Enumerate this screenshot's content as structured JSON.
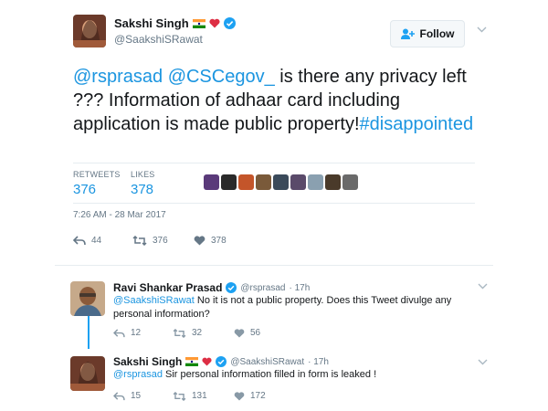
{
  "colors": {
    "link": "#1b95e0",
    "muted": "#657786",
    "heart": "#e0245e",
    "verified": "#1da1f2"
  },
  "main_tweet": {
    "author_name": "Sakshi Singh",
    "author_handle": "@SaakshiSRawat",
    "follow_label": "Follow",
    "text_mention_1": "@rsprasad",
    "text_mention_2": "@CSCegov_",
    "text_body": " is there any privacy left ??? Information of adhaar card including application is made public property!",
    "text_hashtag": "#disappointed",
    "retweets_label": "RETWEETS",
    "retweets_count": "376",
    "likes_label": "LIKES",
    "likes_count": "378",
    "timestamp": "7:26 AM - 28 Mar 2017",
    "actions": {
      "reply": "44",
      "retweet": "376",
      "like": "378"
    }
  },
  "replies": [
    {
      "author_name": "Ravi Shankar Prasad",
      "author_handle": "@rsprasad",
      "time": "· 17h",
      "mention": "@SaakshiSRawat",
      "text": " No it is not a public property. Does this Tweet divulge any personal information?",
      "actions": {
        "reply": "12",
        "retweet": "32",
        "like": "56"
      }
    },
    {
      "author_name": "Sakshi Singh",
      "author_handle": "@SaakshiSRawat",
      "time": "· 17h",
      "mention": "@rsprasad",
      "text": " Sir personal information filled in form is leaked !",
      "actions": {
        "reply": "15",
        "retweet": "131",
        "like": "172"
      }
    }
  ],
  "icons": {
    "reply": "reply-icon",
    "retweet": "retweet-icon",
    "like": "heart-icon",
    "verified": "verified-badge-icon",
    "chevron": "chevron-down-icon",
    "follow": "add-user-icon"
  }
}
